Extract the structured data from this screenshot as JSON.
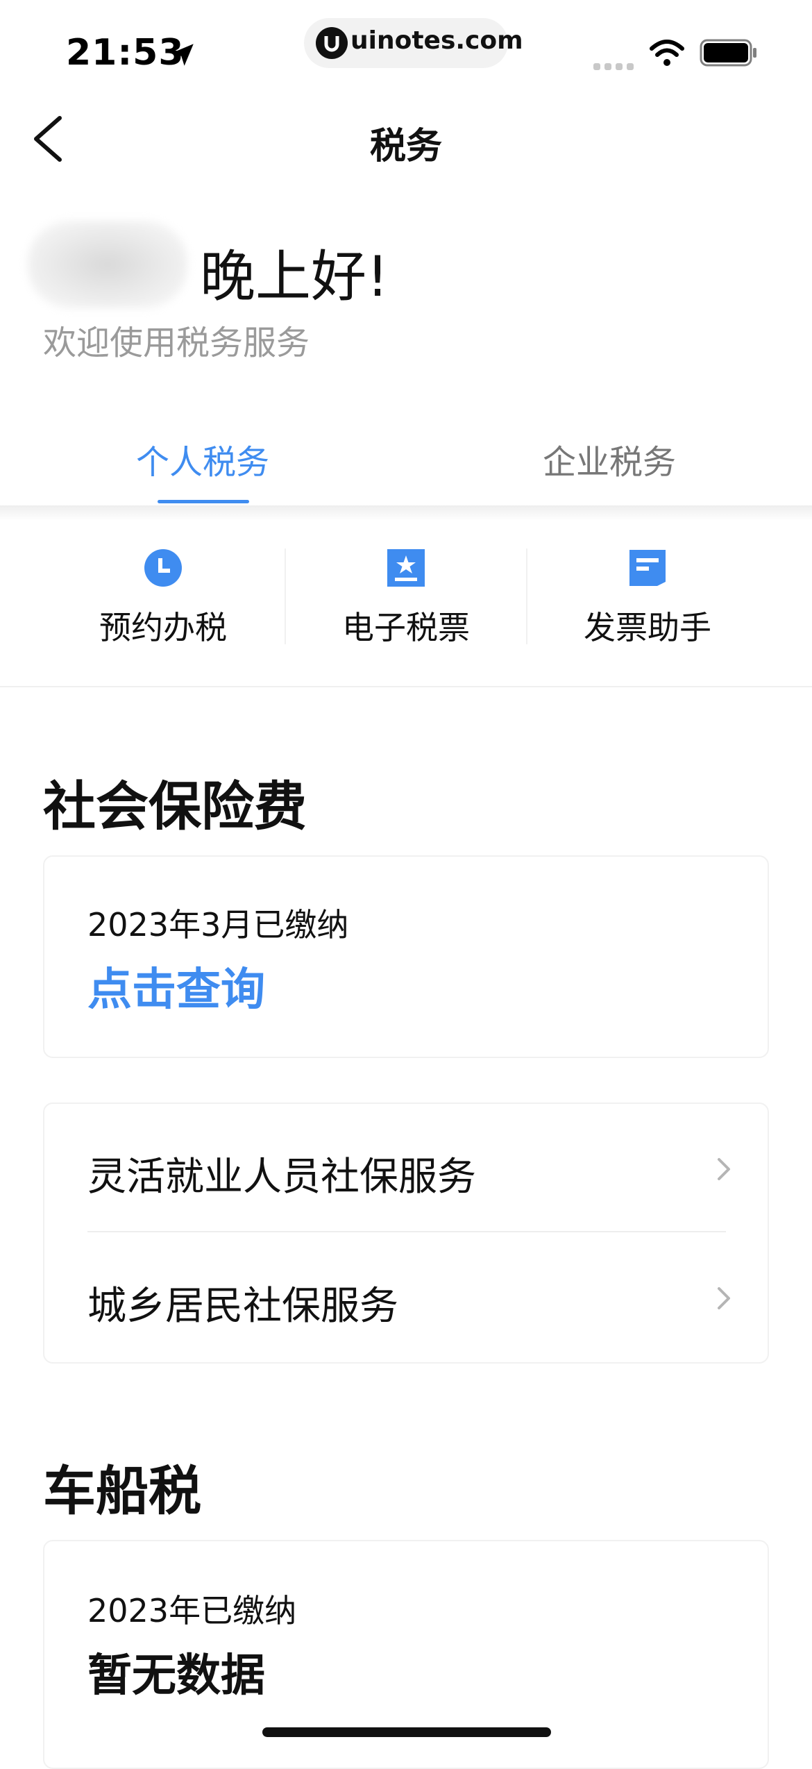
{
  "status_bar": {
    "time": "21:53",
    "url": "uinotes.com",
    "icons": [
      "location-arrow-icon",
      "wifi-icon",
      "battery-icon",
      "signal-icon"
    ]
  },
  "nav": {
    "title": "税务",
    "back_icon": "chevron-left-icon"
  },
  "greeting": {
    "title": "晚上好!",
    "subtitle": "欢迎使用税务服务"
  },
  "tabs": [
    {
      "label": "个人税务",
      "active": true
    },
    {
      "label": "企业税务",
      "active": false
    }
  ],
  "quick_actions": [
    {
      "label": "预约办税",
      "icon": "clock-icon"
    },
    {
      "label": "电子税票",
      "icon": "star-ticket-icon"
    },
    {
      "label": "发票助手",
      "icon": "document-icon"
    }
  ],
  "social_insurance": {
    "title": "社会保险费",
    "paid_text": "2023年3月已缴纳",
    "query_link": "点击查询",
    "services": [
      {
        "label": "灵活就业人员社保服务"
      },
      {
        "label": "城乡居民社保服务"
      }
    ]
  },
  "vehicle_tax": {
    "title": "车船税",
    "paid_text": "2023年已缴纳",
    "value": "暂无数据"
  },
  "colors": {
    "accent": "#3f8cf0",
    "text_primary": "#111111",
    "text_secondary": "#9a9a9a",
    "divider": "#f1f1f1"
  }
}
